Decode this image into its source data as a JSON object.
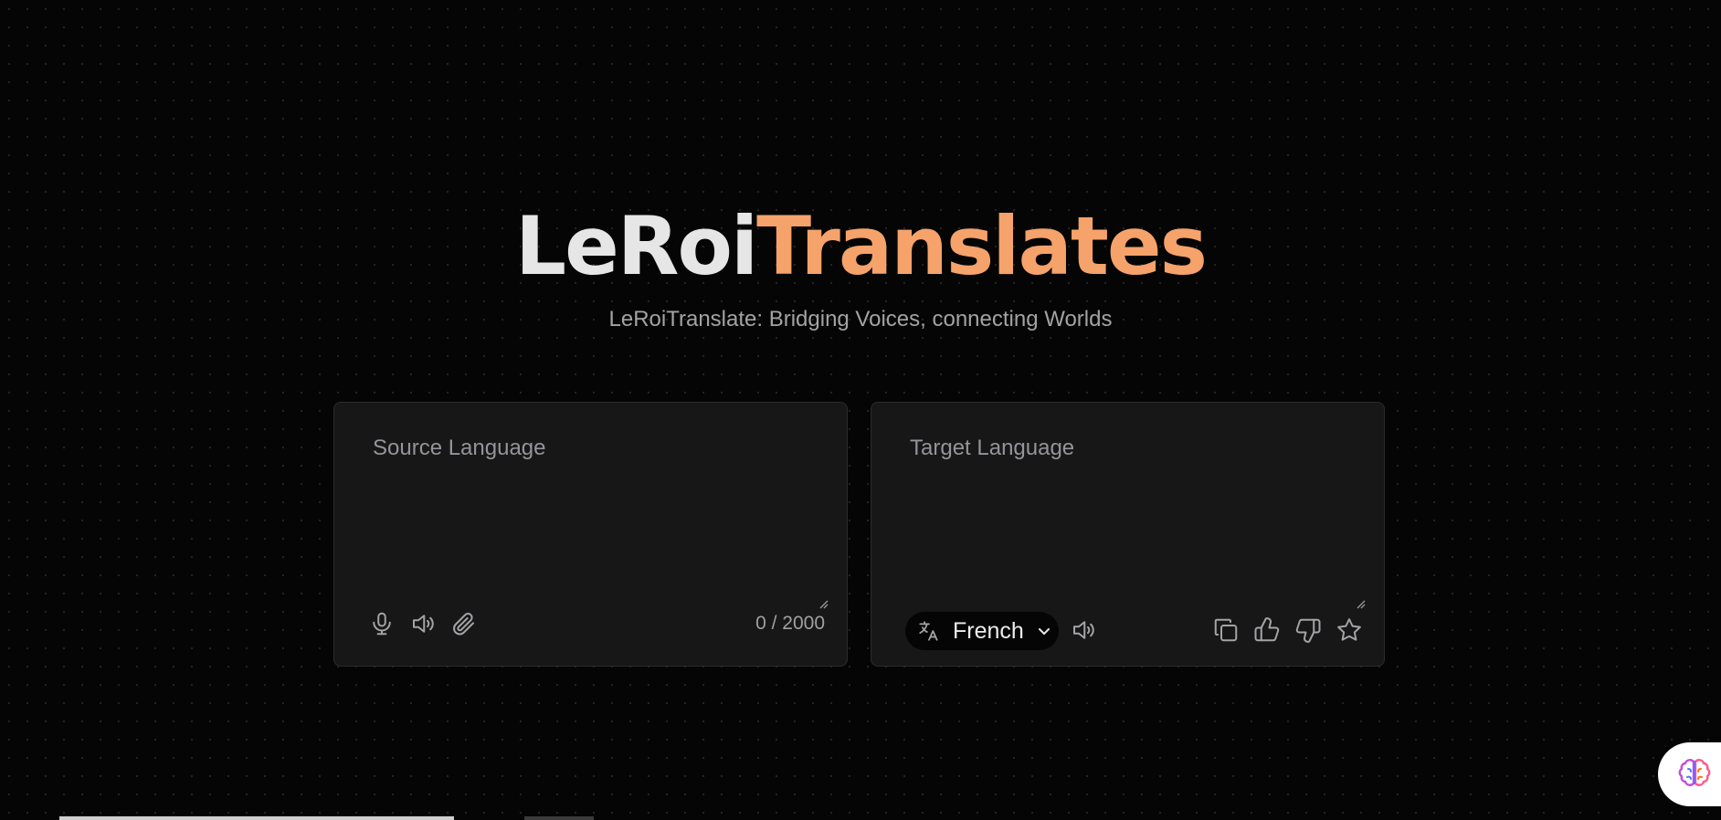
{
  "hero": {
    "title_part1": "LeRoi",
    "title_part2": "Translates",
    "subtitle": "LeRoiTranslate: Bridging Voices, connecting Worlds"
  },
  "source": {
    "placeholder": "Source Language",
    "value": "",
    "counter": "0 / 2000",
    "icons": [
      "microphone-icon",
      "speaker-icon",
      "paperclip-icon"
    ]
  },
  "target": {
    "placeholder": "Target Language",
    "value": "",
    "language": "French",
    "icons": [
      "translate-icon",
      "chevron-down-icon",
      "speaker-icon",
      "copy-icon",
      "thumbs-up-icon",
      "thumbs-down-icon",
      "star-icon"
    ]
  },
  "colors": {
    "background": "#050505",
    "panel": "#171717",
    "accent": "#f5a26b",
    "title_text": "#e6e6e6"
  }
}
